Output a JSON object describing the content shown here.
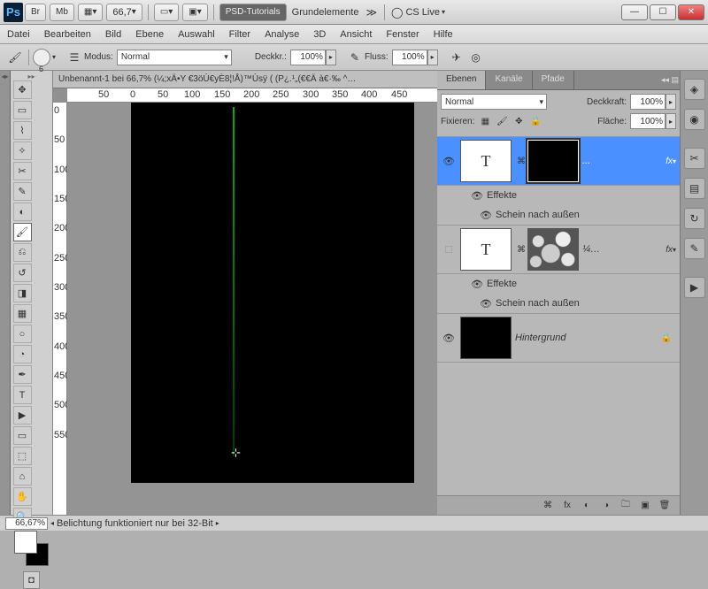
{
  "app": {
    "logo": "Ps",
    "br": "Br",
    "mb": "Mb",
    "zoom": "66,7",
    "cslive": "CS Live"
  },
  "title_tabs": {
    "a": "PSD-Tutorials",
    "b": "Grundelemente"
  },
  "menu": {
    "datei": "Datei",
    "bearbeiten": "Bearbeiten",
    "bild": "Bild",
    "ebene": "Ebene",
    "auswahl": "Auswahl",
    "filter": "Filter",
    "analyse": "Analyse",
    "dd": "3D",
    "ansicht": "Ansicht",
    "fenster": "Fenster",
    "hilfe": "Hilfe"
  },
  "opt": {
    "brush_size": "6",
    "modus_lbl": "Modus:",
    "modus_val": "Normal",
    "deck_lbl": "Deckkr.:",
    "deck_val": "100%",
    "fluss_lbl": "Fluss:",
    "fluss_val": "100%"
  },
  "doc": {
    "tab": "Unbenannt-1 bei 66,7% (¼;xÄ•Y €3öÚ€yÈ8¦!Å)™Ùsÿ      (  (P¿.¹„(€€Ä à€·‰ ^…"
  },
  "ruler_h": {
    "m50": "50",
    "p0": "0",
    "p50": "50",
    "p100": "100",
    "p150": "150",
    "p200": "200",
    "p250": "250",
    "p300": "300",
    "p350": "350",
    "p400": "400",
    "p450": "450"
  },
  "ruler_v": {
    "p0": "0",
    "p50": "50",
    "p100": "100",
    "p150": "150",
    "p200": "200",
    "p250": "250",
    "p300": "300",
    "p350": "350",
    "p400": "400",
    "p450": "450",
    "p500": "500",
    "p550": "550"
  },
  "panels": {
    "ebenen": "Ebenen",
    "kanale": "Kanäle",
    "pfade": "Pfade",
    "blend": "Normal",
    "deck_lbl": "Deckkraft:",
    "deck_val": "100%",
    "fix_lbl": "Fixieren:",
    "flaeche_lbl": "Fläche:",
    "flaeche_val": "100%"
  },
  "layers": {
    "l1": {
      "name": "...",
      "thumb": "T",
      "fx": "fx",
      "effekte": "Effekte",
      "glow": "Schein nach außen"
    },
    "l2": {
      "name": "¼…",
      "thumb": "T",
      "fx": "fx",
      "effekte": "Effekte",
      "glow": "Schein nach außen"
    },
    "bg": {
      "name": "Hintergrund"
    }
  },
  "status": {
    "zoom": "66,67%",
    "msg": "Belichtung funktioniert nur bei 32-Bit"
  }
}
